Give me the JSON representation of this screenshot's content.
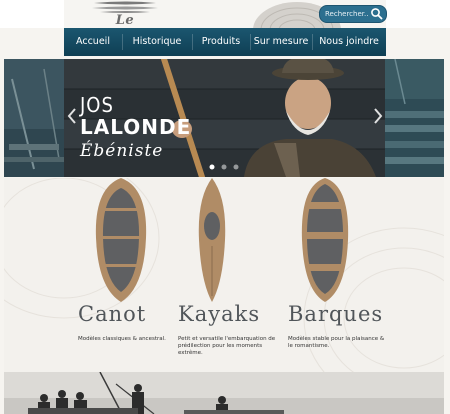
{
  "header": {
    "logo_text": "Le Draveur",
    "search_placeholder": "Rechercher..."
  },
  "nav": {
    "items": [
      {
        "label": "Accueil"
      },
      {
        "label": "Historique"
      },
      {
        "label": "Produits"
      },
      {
        "label": "Sur mesure"
      },
      {
        "label": "Nous joindre"
      }
    ]
  },
  "hero": {
    "line1": "JOS",
    "line2": "LALONDE",
    "line3": "Ébéniste"
  },
  "products": [
    {
      "title": "Canot",
      "description": "Modèles classiques & ancestral."
    },
    {
      "title": "Kayaks",
      "description": "Petit et versatile l'embarquation de prédilection pour les moments extrême."
    },
    {
      "title": "Barques",
      "description": "Modèles stable pour la plaisance & le romantisme."
    }
  ],
  "colors": {
    "nav_bg": "#1b566f",
    "search_bg": "#2c6f8f",
    "boat_wood": "#b08c66",
    "boat_dark": "#5f6062"
  }
}
